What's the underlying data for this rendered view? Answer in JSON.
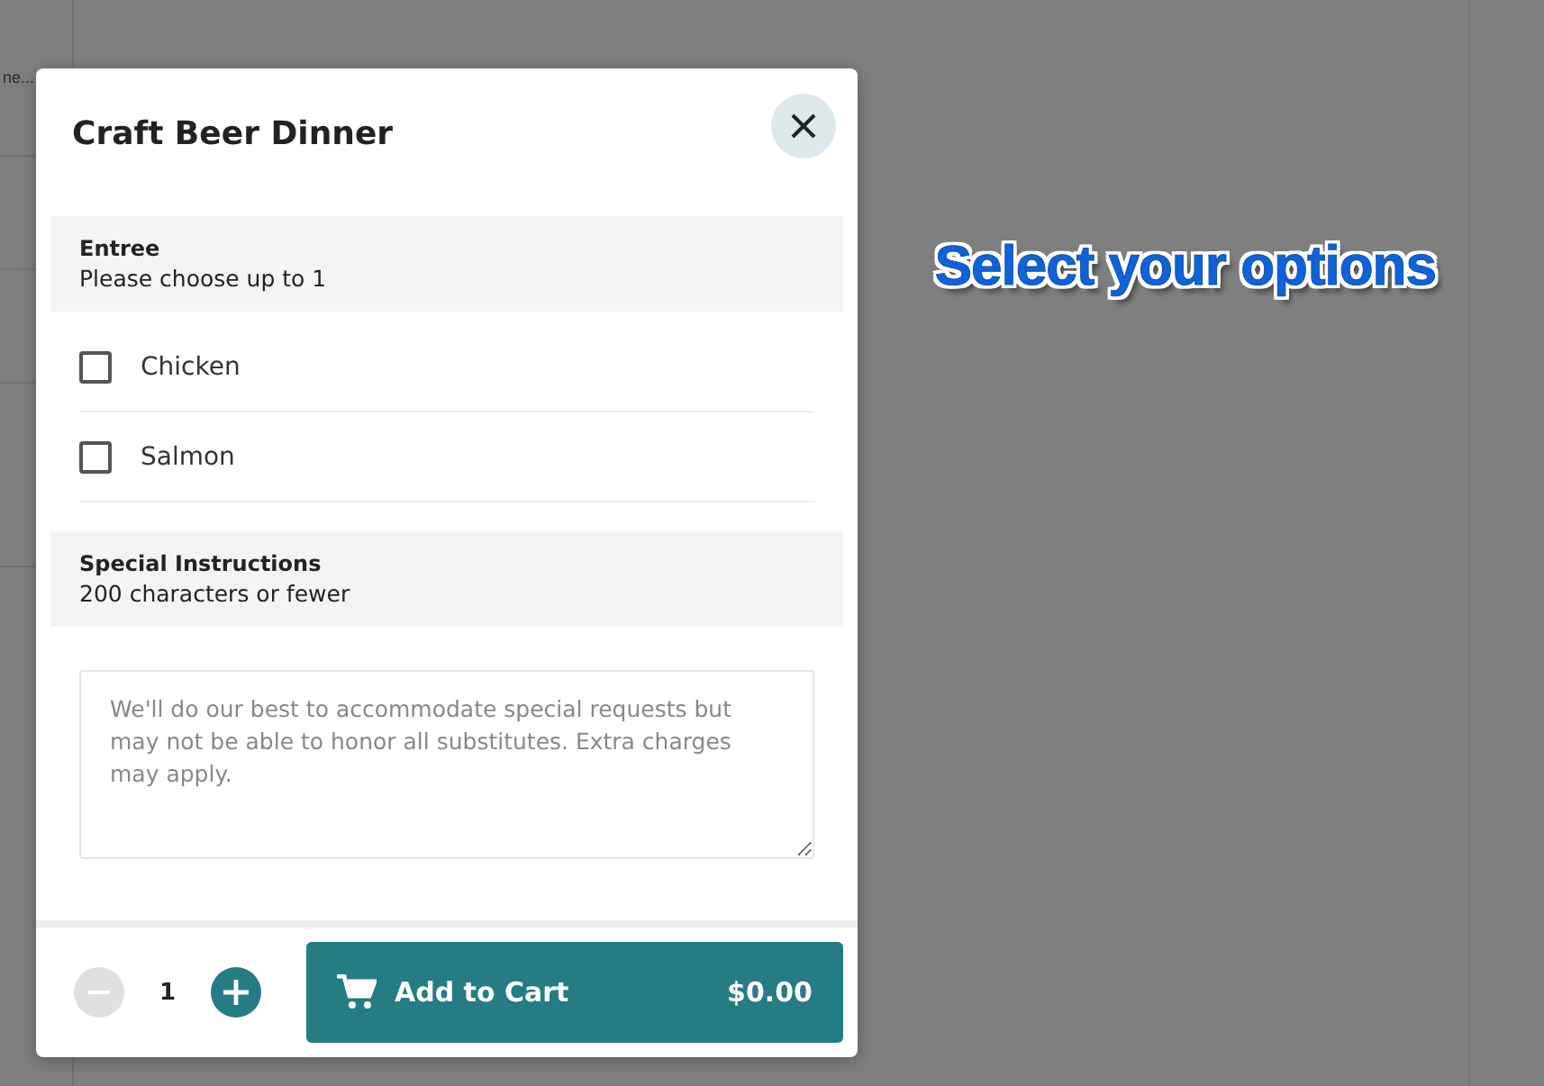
{
  "background": {
    "list_text": "ne..."
  },
  "callout": "Select your options",
  "dialog": {
    "title": "Craft Beer Dinner",
    "sections": [
      {
        "kind": "checkboxes",
        "title": "Entree",
        "subtitle": "Please choose up to 1",
        "options": [
          {
            "label": "Chicken",
            "checked": false
          },
          {
            "label": "Salmon",
            "checked": false
          }
        ]
      },
      {
        "kind": "textarea",
        "title": "Special Instructions",
        "subtitle": "200 characters or fewer",
        "placeholder": "We'll do our best to accommodate special requests but may not be able to honor all substitutes. Extra charges may apply."
      }
    ],
    "quantity": {
      "value": "1",
      "decrease_disabled": true
    },
    "add_button": {
      "label": "Add to Cart",
      "price": "$0.00"
    }
  }
}
